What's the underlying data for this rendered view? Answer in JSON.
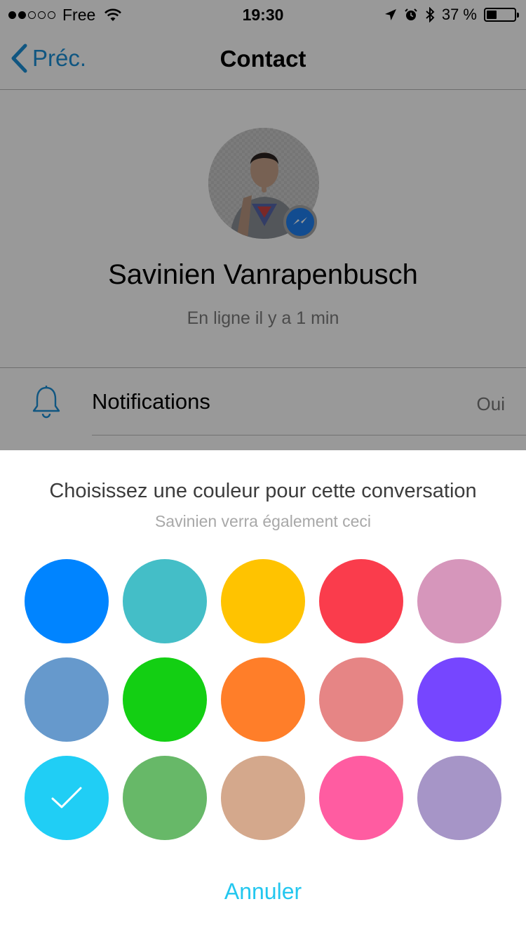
{
  "status_bar": {
    "carrier": "Free",
    "time": "19:30",
    "battery": "37 %",
    "battery_level": 0.37,
    "signal_bars": 2
  },
  "nav": {
    "back_label": "Préc.",
    "title": "Contact"
  },
  "profile": {
    "name": "Savinien Vanrapenbusch",
    "status": "En ligne il y a 1 min"
  },
  "settings": {
    "notifications_label": "Notifications",
    "notifications_value": "Oui"
  },
  "color_sheet": {
    "title": "Choisissez une couleur pour cette conversation",
    "subtitle": "Savinien verra également ceci",
    "cancel_label": "Annuler",
    "selected_index": 10,
    "colors": [
      "#0084ff",
      "#44bec7",
      "#ffc300",
      "#fa3c4c",
      "#d696bb",
      "#6699cc",
      "#13cf13",
      "#ff7e29",
      "#e68585",
      "#7646ff",
      "#20cef5",
      "#67b868",
      "#d4a88c",
      "#ff5ca1",
      "#a695c7"
    ]
  }
}
